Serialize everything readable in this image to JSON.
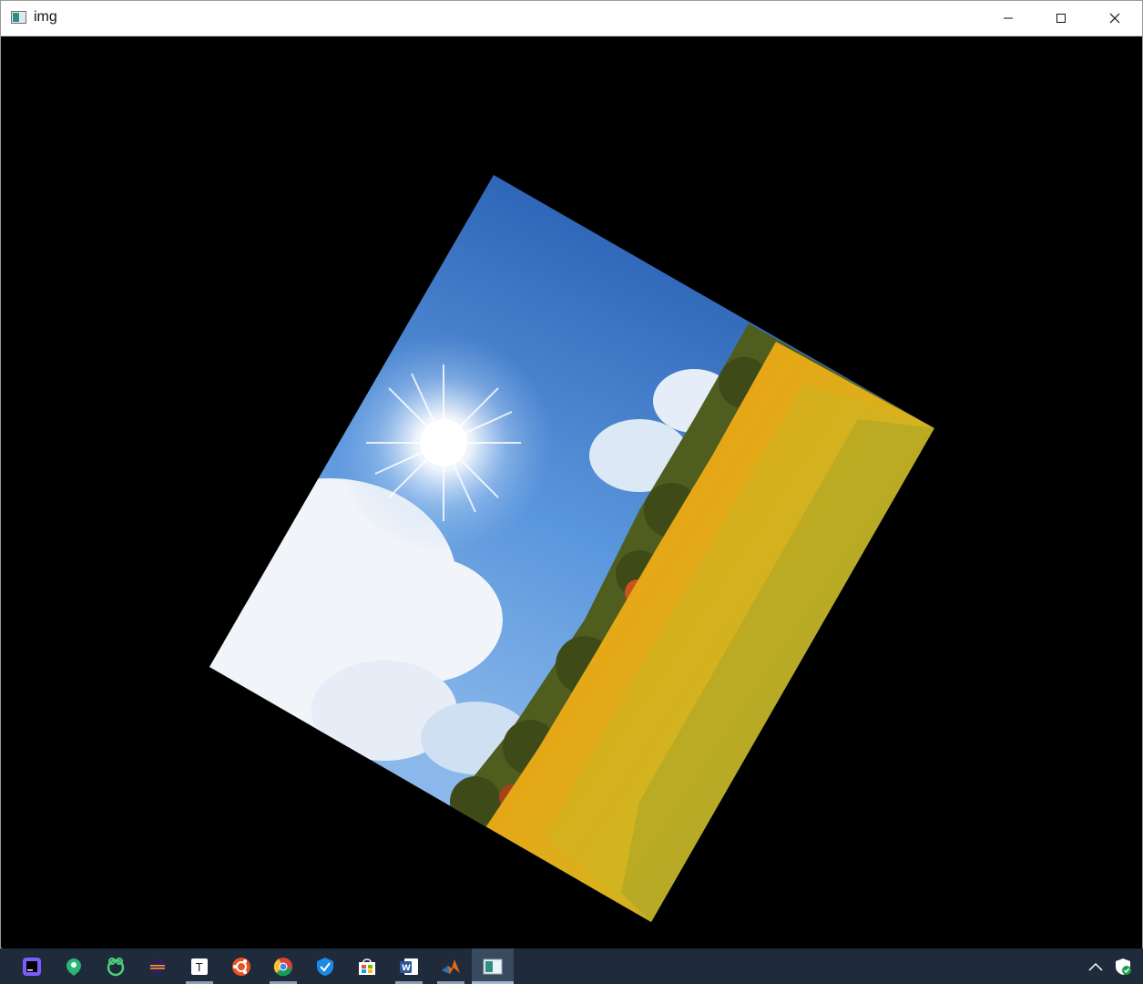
{
  "window": {
    "title": "img",
    "controls": {
      "minimize": "minimize-icon",
      "maximize": "maximize-icon",
      "close": "close-icon"
    }
  },
  "canvas": {
    "background": "#000000",
    "content": "rotated-landscape-image",
    "scene": {
      "sky": "#3a78c8",
      "sun": "#ffffff",
      "clouds": "#f2f5f9",
      "trees": "#4a5a1e",
      "field": "#e0a412"
    }
  },
  "taskbar": {
    "background": "#1f2b3b",
    "items": [
      {
        "icon": "goland-icon",
        "active": false,
        "color": "#7b5cff"
      },
      {
        "icon": "map-pin-icon",
        "active": false,
        "color": "#2bb673"
      },
      {
        "icon": "frog-app-icon",
        "active": false,
        "color": "#4ccf7a"
      },
      {
        "icon": "eclipse-icon",
        "active": false,
        "color": "#f29a2e"
      },
      {
        "icon": "typora-icon",
        "active": false,
        "color": "#ffffff"
      },
      {
        "icon": "ubuntu-icon",
        "active": false,
        "color": "#e95420"
      },
      {
        "icon": "chrome-icon",
        "active": false,
        "color": "#fbc02d"
      },
      {
        "icon": "shield-check-icon",
        "active": false,
        "color": "#1e88e5"
      },
      {
        "icon": "store-icon",
        "active": false,
        "color": "#2a80e8"
      },
      {
        "icon": "word-icon",
        "active": false,
        "color": "#2b579a"
      },
      {
        "icon": "matlab-icon",
        "active": false,
        "color": "#e86a19"
      },
      {
        "icon": "img-window-icon",
        "active": true,
        "color": "#2d8f84"
      }
    ],
    "tray": {
      "chevron": "chevron-up-icon",
      "security": "windows-security-icon"
    }
  }
}
